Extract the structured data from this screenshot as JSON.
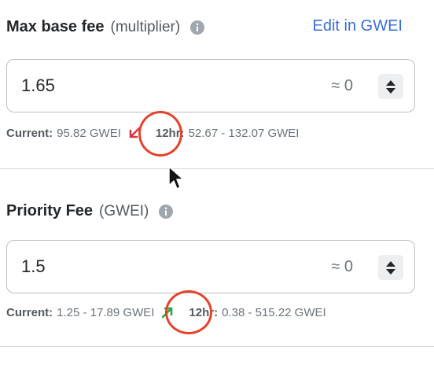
{
  "max_base_fee": {
    "title": "Max base fee",
    "subtitle": "(multiplier)",
    "edit_link": "Edit in GWEI",
    "value": "1.65",
    "approx": "≈ 0",
    "current_label": "Current:",
    "current_value": "95.82 GWEI",
    "trend": "down",
    "range_label": "12hr:",
    "range_value": "52.67 - 132.07 GWEI"
  },
  "priority_fee": {
    "title": "Priority Fee",
    "subtitle": "(GWEI)",
    "value": "1.5",
    "approx": "≈ 0",
    "current_label": "Current:",
    "current_value": "1.25 - 17.89 GWEI",
    "trend": "up",
    "range_label": "12hr:",
    "range_value": "0.38 - 515.22 GWEI"
  },
  "colors": {
    "trend_down": "#d73847",
    "trend_up": "#28a745",
    "link": "#3a6fd8",
    "annotation": "#e3432b"
  }
}
